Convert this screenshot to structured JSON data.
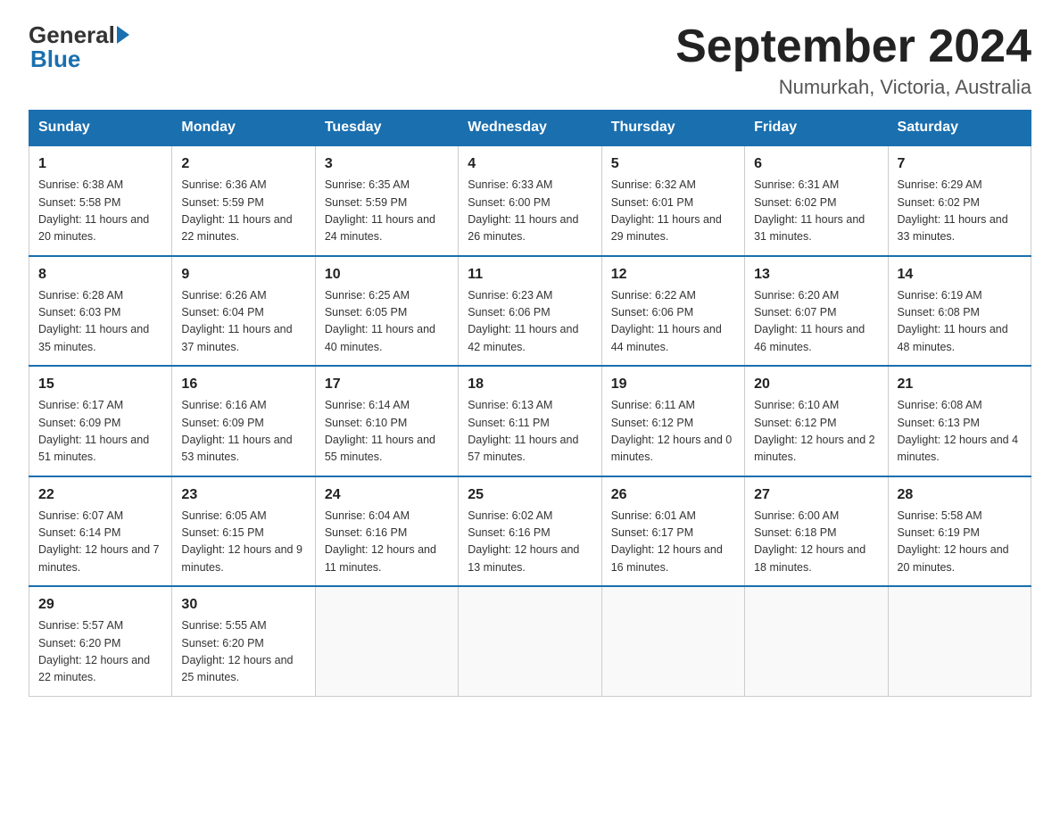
{
  "logo": {
    "general": "General",
    "blue": "Blue"
  },
  "title": "September 2024",
  "subtitle": "Numurkah, Victoria, Australia",
  "days_of_week": [
    "Sunday",
    "Monday",
    "Tuesday",
    "Wednesday",
    "Thursday",
    "Friday",
    "Saturday"
  ],
  "weeks": [
    [
      {
        "day": 1,
        "sunrise": "6:38 AM",
        "sunset": "5:58 PM",
        "daylight": "11 hours and 20 minutes."
      },
      {
        "day": 2,
        "sunrise": "6:36 AM",
        "sunset": "5:59 PM",
        "daylight": "11 hours and 22 minutes."
      },
      {
        "day": 3,
        "sunrise": "6:35 AM",
        "sunset": "5:59 PM",
        "daylight": "11 hours and 24 minutes."
      },
      {
        "day": 4,
        "sunrise": "6:33 AM",
        "sunset": "6:00 PM",
        "daylight": "11 hours and 26 minutes."
      },
      {
        "day": 5,
        "sunrise": "6:32 AM",
        "sunset": "6:01 PM",
        "daylight": "11 hours and 29 minutes."
      },
      {
        "day": 6,
        "sunrise": "6:31 AM",
        "sunset": "6:02 PM",
        "daylight": "11 hours and 31 minutes."
      },
      {
        "day": 7,
        "sunrise": "6:29 AM",
        "sunset": "6:02 PM",
        "daylight": "11 hours and 33 minutes."
      }
    ],
    [
      {
        "day": 8,
        "sunrise": "6:28 AM",
        "sunset": "6:03 PM",
        "daylight": "11 hours and 35 minutes."
      },
      {
        "day": 9,
        "sunrise": "6:26 AM",
        "sunset": "6:04 PM",
        "daylight": "11 hours and 37 minutes."
      },
      {
        "day": 10,
        "sunrise": "6:25 AM",
        "sunset": "6:05 PM",
        "daylight": "11 hours and 40 minutes."
      },
      {
        "day": 11,
        "sunrise": "6:23 AM",
        "sunset": "6:06 PM",
        "daylight": "11 hours and 42 minutes."
      },
      {
        "day": 12,
        "sunrise": "6:22 AM",
        "sunset": "6:06 PM",
        "daylight": "11 hours and 44 minutes."
      },
      {
        "day": 13,
        "sunrise": "6:20 AM",
        "sunset": "6:07 PM",
        "daylight": "11 hours and 46 minutes."
      },
      {
        "day": 14,
        "sunrise": "6:19 AM",
        "sunset": "6:08 PM",
        "daylight": "11 hours and 48 minutes."
      }
    ],
    [
      {
        "day": 15,
        "sunrise": "6:17 AM",
        "sunset": "6:09 PM",
        "daylight": "11 hours and 51 minutes."
      },
      {
        "day": 16,
        "sunrise": "6:16 AM",
        "sunset": "6:09 PM",
        "daylight": "11 hours and 53 minutes."
      },
      {
        "day": 17,
        "sunrise": "6:14 AM",
        "sunset": "6:10 PM",
        "daylight": "11 hours and 55 minutes."
      },
      {
        "day": 18,
        "sunrise": "6:13 AM",
        "sunset": "6:11 PM",
        "daylight": "11 hours and 57 minutes."
      },
      {
        "day": 19,
        "sunrise": "6:11 AM",
        "sunset": "6:12 PM",
        "daylight": "12 hours and 0 minutes."
      },
      {
        "day": 20,
        "sunrise": "6:10 AM",
        "sunset": "6:12 PM",
        "daylight": "12 hours and 2 minutes."
      },
      {
        "day": 21,
        "sunrise": "6:08 AM",
        "sunset": "6:13 PM",
        "daylight": "12 hours and 4 minutes."
      }
    ],
    [
      {
        "day": 22,
        "sunrise": "6:07 AM",
        "sunset": "6:14 PM",
        "daylight": "12 hours and 7 minutes."
      },
      {
        "day": 23,
        "sunrise": "6:05 AM",
        "sunset": "6:15 PM",
        "daylight": "12 hours and 9 minutes."
      },
      {
        "day": 24,
        "sunrise": "6:04 AM",
        "sunset": "6:16 PM",
        "daylight": "12 hours and 11 minutes."
      },
      {
        "day": 25,
        "sunrise": "6:02 AM",
        "sunset": "6:16 PM",
        "daylight": "12 hours and 13 minutes."
      },
      {
        "day": 26,
        "sunrise": "6:01 AM",
        "sunset": "6:17 PM",
        "daylight": "12 hours and 16 minutes."
      },
      {
        "day": 27,
        "sunrise": "6:00 AM",
        "sunset": "6:18 PM",
        "daylight": "12 hours and 18 minutes."
      },
      {
        "day": 28,
        "sunrise": "5:58 AM",
        "sunset": "6:19 PM",
        "daylight": "12 hours and 20 minutes."
      }
    ],
    [
      {
        "day": 29,
        "sunrise": "5:57 AM",
        "sunset": "6:20 PM",
        "daylight": "12 hours and 22 minutes."
      },
      {
        "day": 30,
        "sunrise": "5:55 AM",
        "sunset": "6:20 PM",
        "daylight": "12 hours and 25 minutes."
      },
      null,
      null,
      null,
      null,
      null
    ]
  ]
}
